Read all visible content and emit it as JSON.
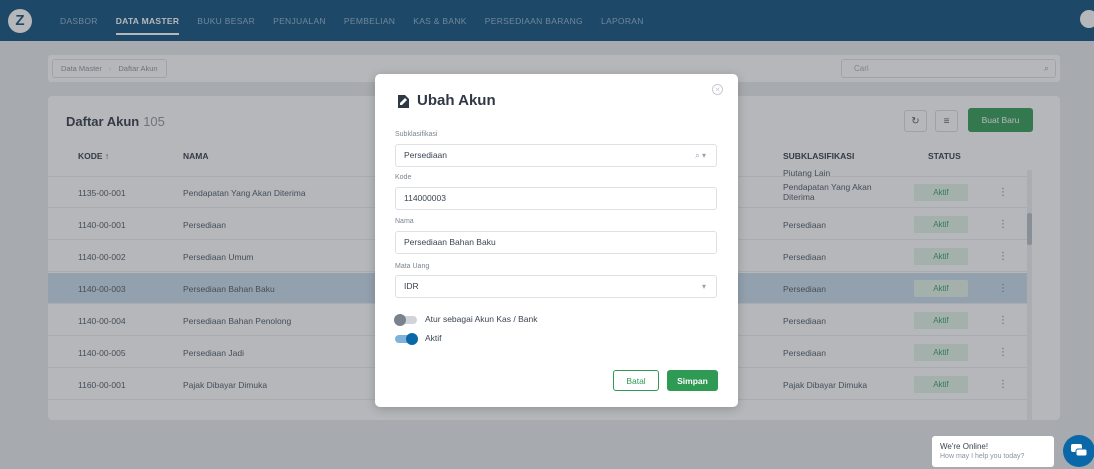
{
  "nav": {
    "logo": "Z",
    "items": [
      {
        "label": "DASBOR",
        "active": false
      },
      {
        "label": "DATA MASTER",
        "active": true
      },
      {
        "label": "BUKU BESAR",
        "active": false
      },
      {
        "label": "PENJUALAN",
        "active": false
      },
      {
        "label": "PEMBELIAN",
        "active": false
      },
      {
        "label": "KAS & BANK",
        "active": false
      },
      {
        "label": "PERSEDIAAN BARANG",
        "active": false
      },
      {
        "label": "LAPORAN",
        "active": false
      }
    ]
  },
  "breadcrumb": [
    "Data Master",
    "Daftar Akun"
  ],
  "search": {
    "placeholder": "Cari",
    "icon": "search-icon"
  },
  "list": {
    "title": "Daftar Akun",
    "count": "105",
    "refresh_icon": "refresh-icon",
    "filter_icon": "filter-icon",
    "new_button": "Buat Baru",
    "columns": {
      "kode": "KODE ↑",
      "nama": "NAMA",
      "subklasifikasi": "SUBKLASIFIKASI",
      "status": "STATUS"
    },
    "partial_row": {
      "subklasifikasi": "Piutang Lain"
    },
    "rows": [
      {
        "kode": "1135-00-001",
        "nama": "Pendapatan Yang Akan Diterima",
        "subklasifikasi": "Pendapatan Yang Akan Diterima",
        "status": "Aktif",
        "selected": false
      },
      {
        "kode": "1140-00-001",
        "nama": "Persediaan",
        "subklasifikasi": "Persediaan",
        "status": "Aktif",
        "selected": false
      },
      {
        "kode": "1140-00-002",
        "nama": "Persediaan Umum",
        "subklasifikasi": "Persediaan",
        "status": "Aktif",
        "selected": false
      },
      {
        "kode": "1140-00-003",
        "nama": "Persediaan Bahan Baku",
        "subklasifikasi": "Persediaan",
        "status": "Aktif",
        "selected": true
      },
      {
        "kode": "1140-00-004",
        "nama": "Persediaan Bahan Penolong",
        "subklasifikasi": "Persediaan",
        "status": "Aktif",
        "selected": false
      },
      {
        "kode": "1140-00-005",
        "nama": "Persediaan Jadi",
        "subklasifikasi": "Persediaan",
        "status": "Aktif",
        "selected": false
      },
      {
        "kode": "1160-00-001",
        "nama": "Pajak Dibayar Dimuka",
        "subklasifikasi": "Pajak Dibayar Dimuka",
        "status": "Aktif",
        "selected": false
      }
    ]
  },
  "modal": {
    "title": "Ubah Akun",
    "subklasifikasi_label": "Subklasifikasi",
    "subklasifikasi_value": "Persediaan",
    "kode_label": "Kode",
    "kode_value": "114000003",
    "nama_label": "Nama",
    "nama_value": "Persediaan Bahan Baku",
    "mata_uang_label": "Mata Uang",
    "mata_uang_value": "IDR",
    "toggle_kas_label": "Atur sebagai Akun Kas / Bank",
    "toggle_kas_on": false,
    "toggle_aktif_label": "Aktif",
    "toggle_aktif_on": true,
    "batal": "Batal",
    "simpan": "Simpan"
  },
  "chat": {
    "title": "We're Online!",
    "subtitle": "How may I help you today?"
  },
  "colors": {
    "nav_bg": "#0b4d7a",
    "primary_green": "#2e9a53",
    "toggle_on": "#0b68a8",
    "selected_row": "#c9dcec"
  }
}
